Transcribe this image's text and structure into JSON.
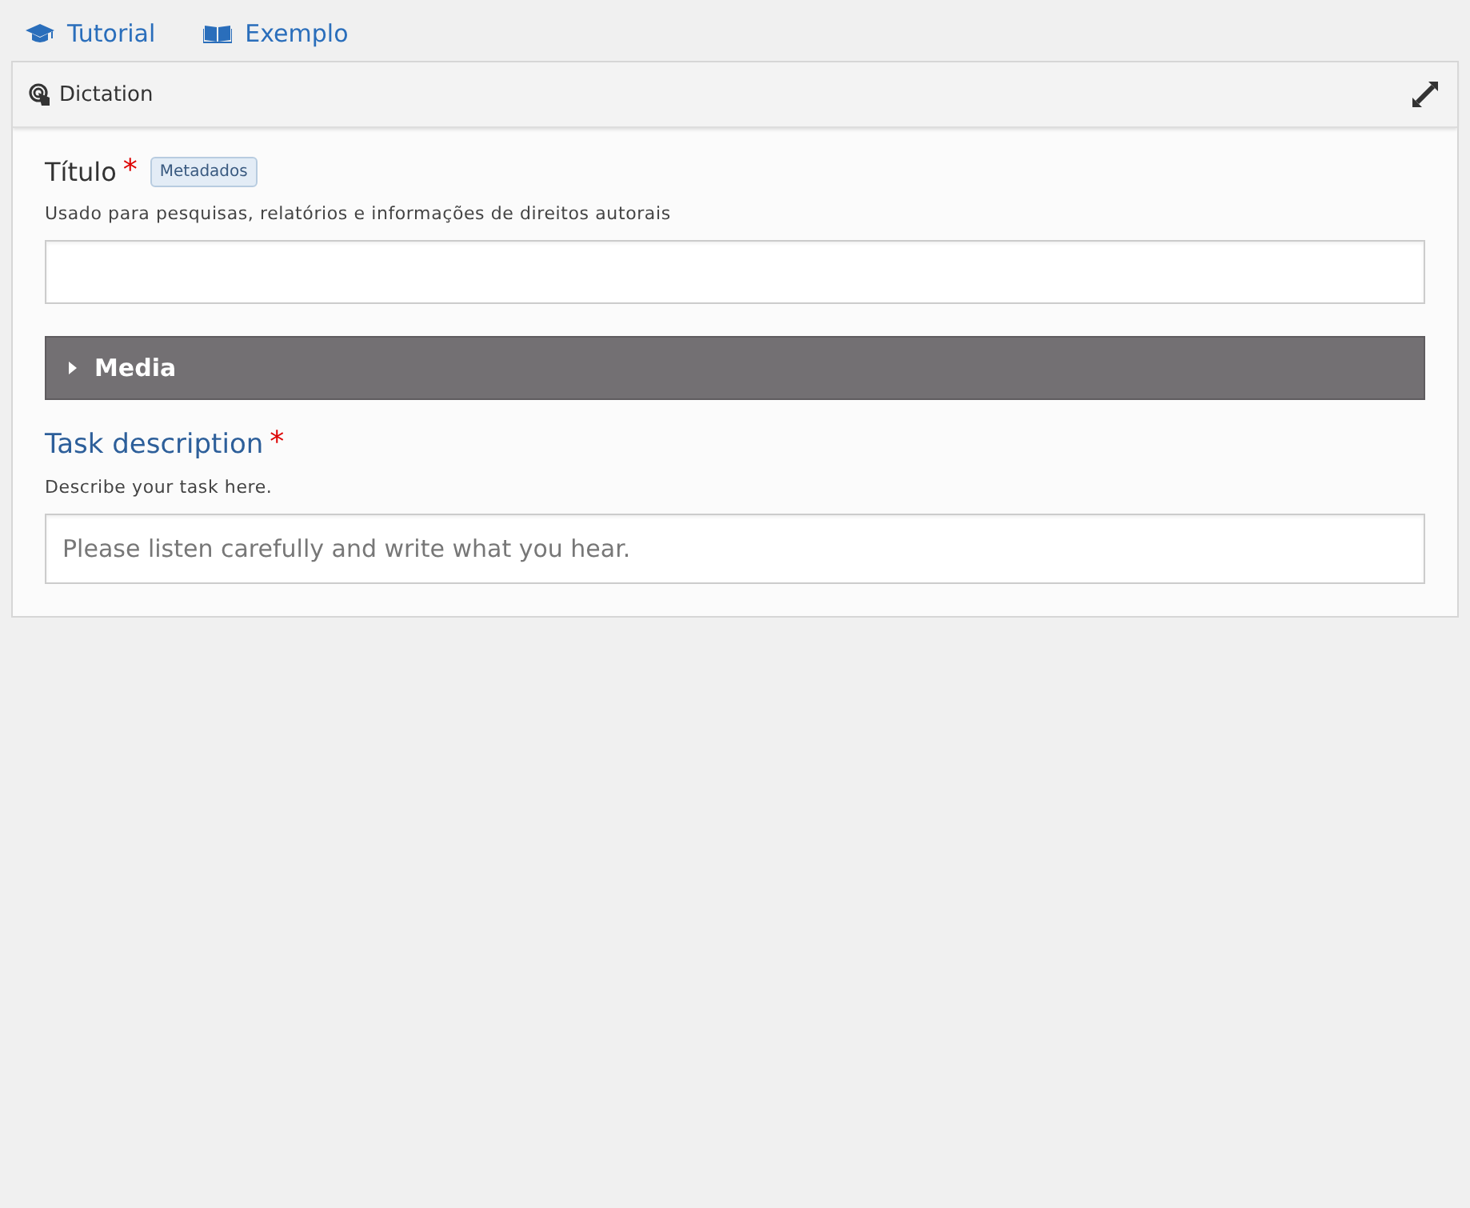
{
  "top_links": [
    {
      "kind": "tutorial",
      "label": "Tutorial"
    },
    {
      "kind": "example",
      "label": "Exemplo"
    }
  ],
  "panel": {
    "title": "Dictation",
    "fields": [
      {
        "kind": "input",
        "label": "Título",
        "required_mark": "*",
        "badge": "Metadados",
        "help": "Usado para pesquisas, relatórios e informações de direitos autorais"
      },
      {
        "kind": "group",
        "label": "Media",
        "expanded": false
      },
      {
        "kind": "textarea",
        "label": "Task description",
        "required_mark": "*",
        "help": "Describe your task here.",
        "placeholder": "Please listen carefully and write what you hear."
      }
    ]
  }
}
